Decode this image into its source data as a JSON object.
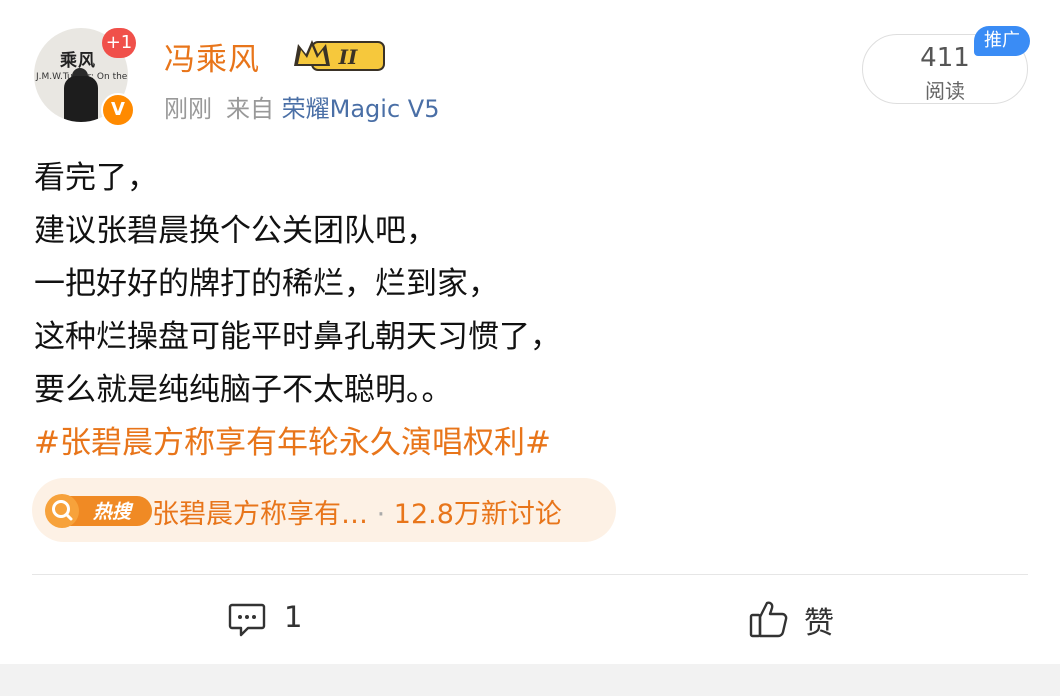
{
  "post": {
    "author": {
      "name": "冯乘风",
      "avatar_text": "乘风",
      "avatar_subtext": "J.M.W.Turner: On the",
      "notification_badge": "+1",
      "verified_badge": "V",
      "rank_badge": "II"
    },
    "meta": {
      "time": "刚刚",
      "source_prefix": "来自",
      "device": "荣耀Magic V5"
    },
    "reads": {
      "count": "411",
      "label": "阅读"
    },
    "ad_tag": "推广",
    "body_lines": [
      "看完了，",
      "建议张碧晨换个公关团队吧，",
      "一把好好的牌打的稀烂，烂到家，",
      "这种烂操盘可能平时鼻孔朝天习惯了，",
      "要么就是纯纯脑子不太聪明。。"
    ],
    "hashtag": "#张碧晨方称享有年轮永久演唱权利#",
    "hot_search": {
      "badge": "热搜",
      "topic": "张碧晨方称享有…",
      "separator": "·",
      "discussions": "12.8万新讨论"
    },
    "actions": {
      "comment_count": "1",
      "like_label": "赞"
    }
  },
  "icons": {
    "comment": "comment-icon",
    "like": "thumbs-up-icon",
    "search": "search-icon",
    "verified": "verified-v-icon",
    "crown": "crown-icon"
  },
  "colors": {
    "accent_orange": "#e8751a",
    "device_blue": "#4a6fa6",
    "ad_blue": "#3a8cf5",
    "badge_red": "#f0504a"
  }
}
